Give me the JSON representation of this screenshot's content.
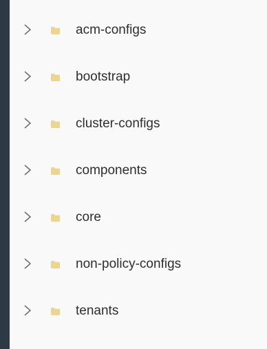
{
  "colors": {
    "background": "#2b3a45",
    "panel": "#f9f9f9",
    "text": "#2e2e2e",
    "chevron": "#6b6b6b",
    "folder": "#ebd590"
  },
  "tree": {
    "items": [
      {
        "label": "acm-configs",
        "expand_icon": "chevron-right-icon",
        "icon": "folder-icon"
      },
      {
        "label": "bootstrap",
        "expand_icon": "chevron-right-icon",
        "icon": "folder-icon"
      },
      {
        "label": "cluster-configs",
        "expand_icon": "chevron-right-icon",
        "icon": "folder-icon"
      },
      {
        "label": "components",
        "expand_icon": "chevron-right-icon",
        "icon": "folder-icon"
      },
      {
        "label": "core",
        "expand_icon": "chevron-right-icon",
        "icon": "folder-icon"
      },
      {
        "label": "non-policy-configs",
        "expand_icon": "chevron-right-icon",
        "icon": "folder-icon"
      },
      {
        "label": "tenants",
        "expand_icon": "chevron-right-icon",
        "icon": "folder-icon"
      }
    ]
  }
}
